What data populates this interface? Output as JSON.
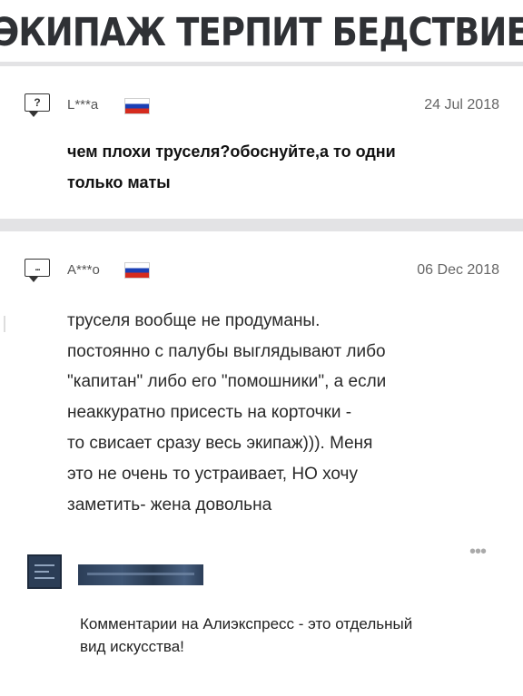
{
  "meme_title": "ЭКИПАЖ ТЕРПИТ БЕДСТВИЕ",
  "reviews": [
    {
      "icon_glyph": "?",
      "username": "L***a",
      "date": "24 Jul 2018",
      "lines": [
        "чем плохи труселя?обоснуйте,а то одни",
        "только маты"
      ]
    },
    {
      "icon_glyph": "...",
      "username": "A***o",
      "date": "06 Dec 2018",
      "lines": [
        "труселя вообще не продуманы.",
        "постоянно с палубы выглядывают либо",
        "\"капитан\" либо его \"помошники\", а если",
        "неаккуратно присесть на корточки -",
        "то свисает сразу весь экипаж))). Меня",
        "это не очень то устраивает, НО хочу",
        "заметить- жена довольна"
      ]
    }
  ],
  "footer": {
    "more_glyph": "•••",
    "caption_lines": [
      "Комментарии на Алиэкспресс - это отдельный",
      "вид искусства!"
    ]
  },
  "colors": {
    "background": "#ffffff",
    "divider": "#e3e3e5",
    "title": "#2f3135",
    "flag_white": "#ffffff",
    "flag_blue": "#1a3fb5",
    "flag_red": "#d52b1e",
    "avatar": "#2b3d56"
  },
  "icons": [
    "question-bubble-icon",
    "russia-flag-icon",
    "ellipsis-bubble-icon",
    "more-dots-icon"
  ]
}
